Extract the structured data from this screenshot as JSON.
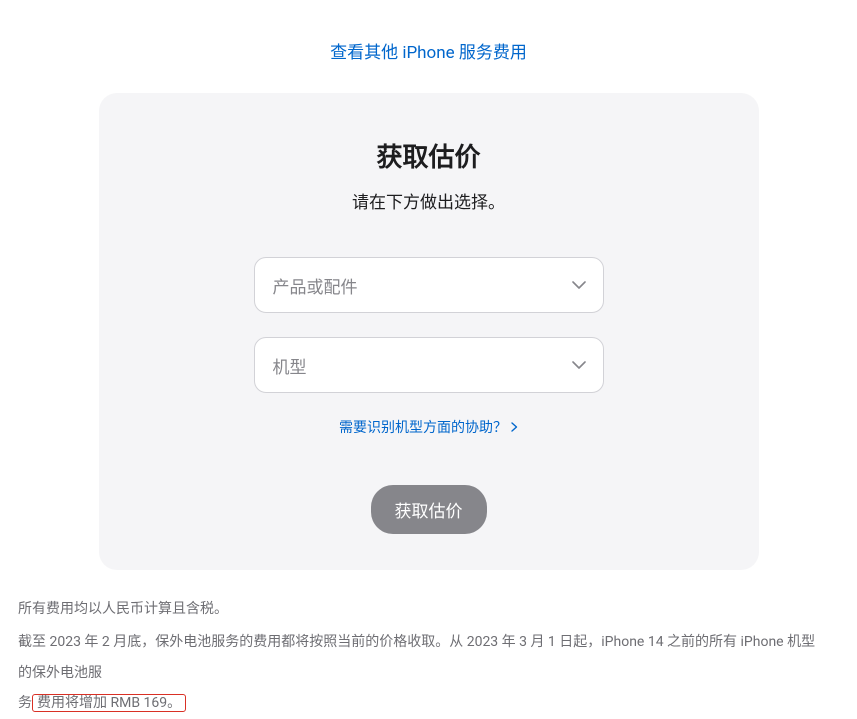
{
  "topLink": "查看其他 iPhone 服务费用",
  "card": {
    "title": "获取估价",
    "subtitle": "请在下方做出选择。",
    "select1Placeholder": "产品或配件",
    "select2Placeholder": "机型",
    "helpLink": "需要识别机型方面的协助？",
    "submitLabel": "获取估价"
  },
  "footer": {
    "line1": "所有费用均以人民币计算且含税。",
    "line2a": "截至 2023 年 2 月底，保外电池服务的费用都将按照当前的价格收取。从 2023 年 3 月 1 日起，iPhone 14 之前的所有 iPhone 机型的保外电池服",
    "line2b": "务",
    "line2c": "费用将增加 RMB 169。"
  }
}
